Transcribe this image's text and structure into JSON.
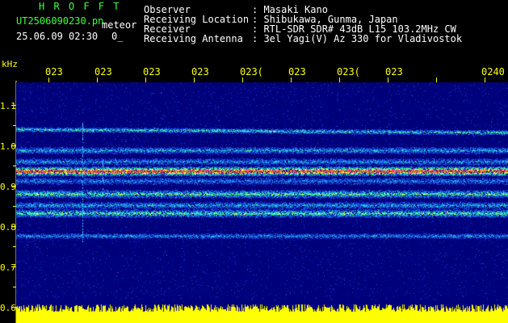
{
  "header": {
    "brand": "H R O F F T",
    "file": "UT2506090230.pn",
    "file_suffix": "meteor",
    "datetime": "25.06.09 02:30",
    "small": "0_",
    "info": [
      {
        "label": "Observer",
        "value": ": Masaki Kano"
      },
      {
        "label": "Receiving Location",
        "value": ": Shibukawa, Gunma, Japan"
      },
      {
        "label": "Receiver",
        "value": ": RTL-SDR SDR# 43dB L15 103.2MHz CW"
      },
      {
        "label": "Receiving Antenna",
        "value": ": 3el Yagi(V) Az 330 for Vladivostok"
      }
    ]
  },
  "axis": {
    "unit": "kHz",
    "y_ticks": [
      "1.1",
      "1.0",
      "0.9",
      "0.8",
      "0.7",
      "0.6"
    ],
    "x_ticks": [
      "023",
      "023",
      "023",
      "023",
      "023(",
      "023",
      "023(",
      "023",
      "0240"
    ]
  },
  "colors": {
    "background": "#000000",
    "spectrum_base": "#00007a",
    "label_yellow": "#ffff00",
    "label_green": "#3cff3c"
  }
}
